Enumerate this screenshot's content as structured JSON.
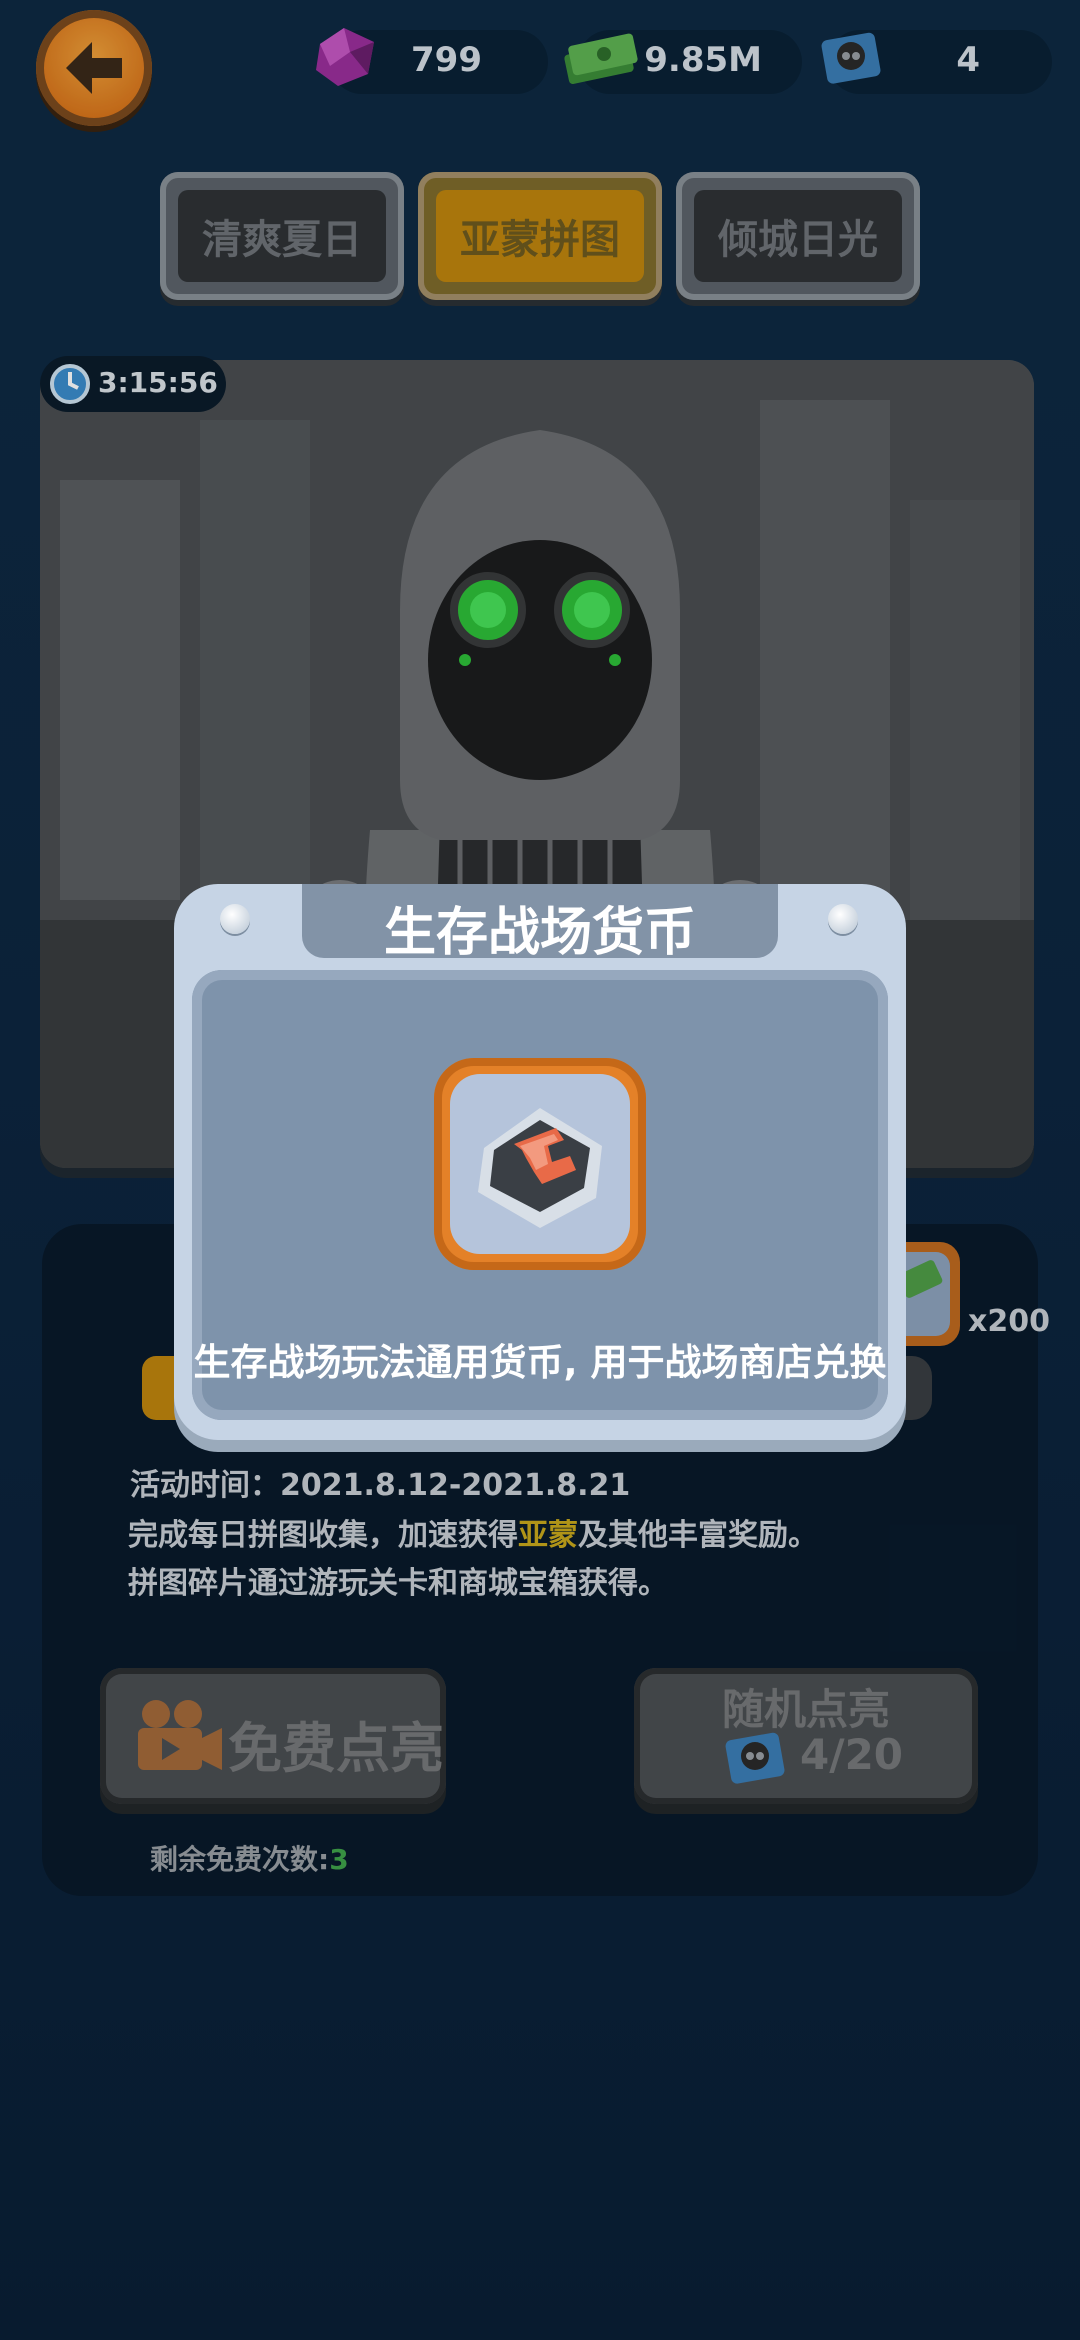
{
  "header": {
    "back_icon": "arrow-left-icon",
    "gems": "799",
    "cash": "9.85M",
    "tokens": "4"
  },
  "tabs": [
    {
      "label": "清爽夏日",
      "active": false
    },
    {
      "label": "亚蒙拼图",
      "active": true
    },
    {
      "label": "倾城日光",
      "active": false
    }
  ],
  "banner": {
    "timer": "3:15:56"
  },
  "panel": {
    "reward_count": "x200",
    "activity_time": "活动时间：2021.8.12-2021.8.21",
    "desc1_before": "完成每日拼图收集，加速获得",
    "desc1_highlight": "亚蒙",
    "desc1_after": "及其他丰富奖励。",
    "desc2": "拼图碎片通过游玩关卡和商城宝箱获得。",
    "free_button": "免费点亮",
    "random_button": "随机点亮",
    "random_count": "4/20",
    "remaining_label": "剩余免费次数:",
    "remaining_value": "3"
  },
  "modal": {
    "title": "生存战场货币",
    "description": "生存战场玩法通用货币, 用于战场商店兑换"
  },
  "colors": {
    "accent_orange": "#e48128",
    "tab_active": "#c0860e",
    "highlight_yellow": "#c9a91c",
    "remaining_green": "#3fa34a"
  }
}
